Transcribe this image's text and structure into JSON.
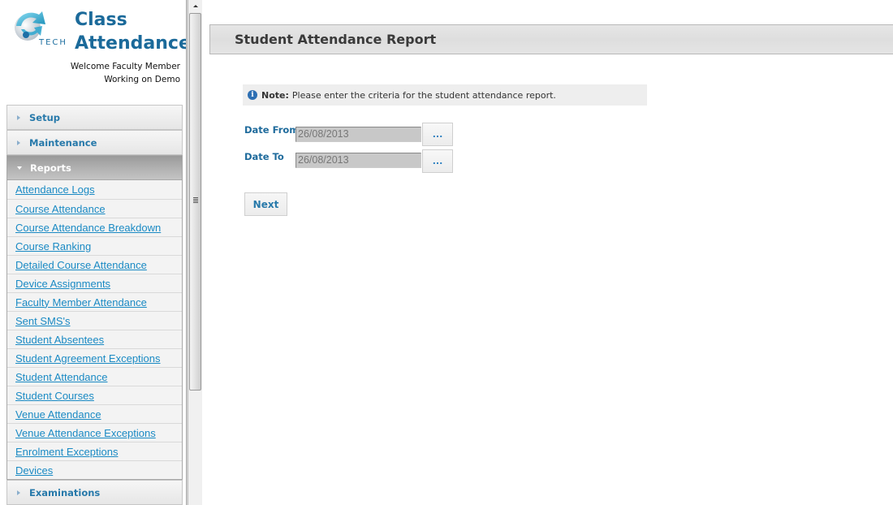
{
  "app": {
    "logo_text": "TECH",
    "title_line1": "Class",
    "title_line2": "Attendance",
    "welcome": "Welcome Faculty Member",
    "working_on": "Working on Demo",
    "brand_color": "#1b6a9a"
  },
  "sidebar": {
    "sections": [
      {
        "label": "Setup",
        "expanded": false
      },
      {
        "label": "Maintenance",
        "expanded": false
      },
      {
        "label": "Reports",
        "expanded": true
      },
      {
        "label": "Examinations",
        "expanded": false
      }
    ],
    "reports_items": [
      {
        "label": "Attendance Logs"
      },
      {
        "label": "Course Attendance"
      },
      {
        "label": "Course Attendance Breakdown"
      },
      {
        "label": "Course Ranking"
      },
      {
        "label": "Detailed Course Attendance"
      },
      {
        "label": "Device Assignments"
      },
      {
        "label": "Faculty Member Attendance"
      },
      {
        "label": "Sent SMS's"
      },
      {
        "label": "Student Absentees"
      },
      {
        "label": "Student Agreement Exceptions"
      },
      {
        "label": "Student Attendance"
      },
      {
        "label": "Student Courses"
      },
      {
        "label": "Venue Attendance"
      },
      {
        "label": "Venue Attendance Exceptions"
      },
      {
        "label": "Enrolment Exceptions"
      },
      {
        "label": "Devices"
      }
    ]
  },
  "main": {
    "page_title": "Student Attendance Report",
    "note": {
      "icon": "info-icon",
      "icon_glyph": "i",
      "label": "Note:",
      "text": "Please enter the criteria for the student attendance report."
    },
    "form": {
      "date_from_label": "Date From",
      "date_from_value": "26/08/2013",
      "date_to_label": "Date To",
      "date_to_value": "26/08/2013",
      "picker_label": "...",
      "next_label": "Next"
    }
  }
}
